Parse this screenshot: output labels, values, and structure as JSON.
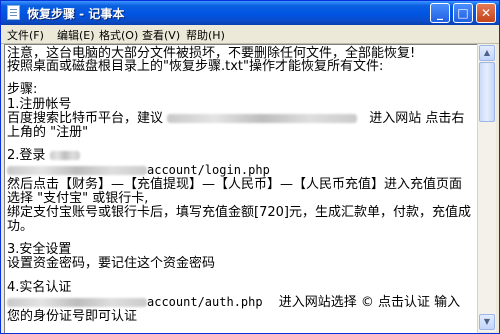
{
  "window": {
    "title": "恢复步骤 - 记事本",
    "controls": {
      "minimize": "_",
      "maximize": "□",
      "close": "✕"
    }
  },
  "menu": [
    "文件(F)",
    "编辑(E)",
    "格式(O)",
    "查看(V)",
    "帮助(H)"
  ],
  "content": {
    "l1": "注意，这台电脑的大部分文件被损坏，不要删除任何文件，全部能恢复!",
    "l2": "按照桌面或磁盘根目录上的\"恢复步骤.txt\"操作才能恢复所有文件:",
    "l4": "步骤:",
    "l5": "1.注册帐号",
    "l6a": "百度搜索比特币平台，建议",
    "l6b": "进入网站 点击右",
    "l7": "上角的 \"注册\"",
    "l9a": "2.登录",
    "l10": "account/login.php",
    "l11": "然后点击【财务】—【充值提现】—【人民币】—【人民币充值】进入充值页面",
    "l12": "选择 \"支付宝\" 或银行卡,",
    "l13": "绑定支付宝账号或银行卡后，填写充值金额[720]元，生成汇款单，付款，充值成",
    "l14": "功。",
    "l16": "3.安全设置",
    "l17": "设置资金密码，要记住这个资金密码",
    "l19": "4.实名认证",
    "l20a": "account/auth.php",
    "l20b": "进入网站选择 © 点击认证 输入",
    "l21": "您的身份证号即可认证"
  },
  "colors": {
    "titlebar": "#0054e3",
    "close_button": "#c4431a",
    "editor_bg": "#ffffff"
  },
  "icons": {
    "app": "notepad-icon"
  }
}
